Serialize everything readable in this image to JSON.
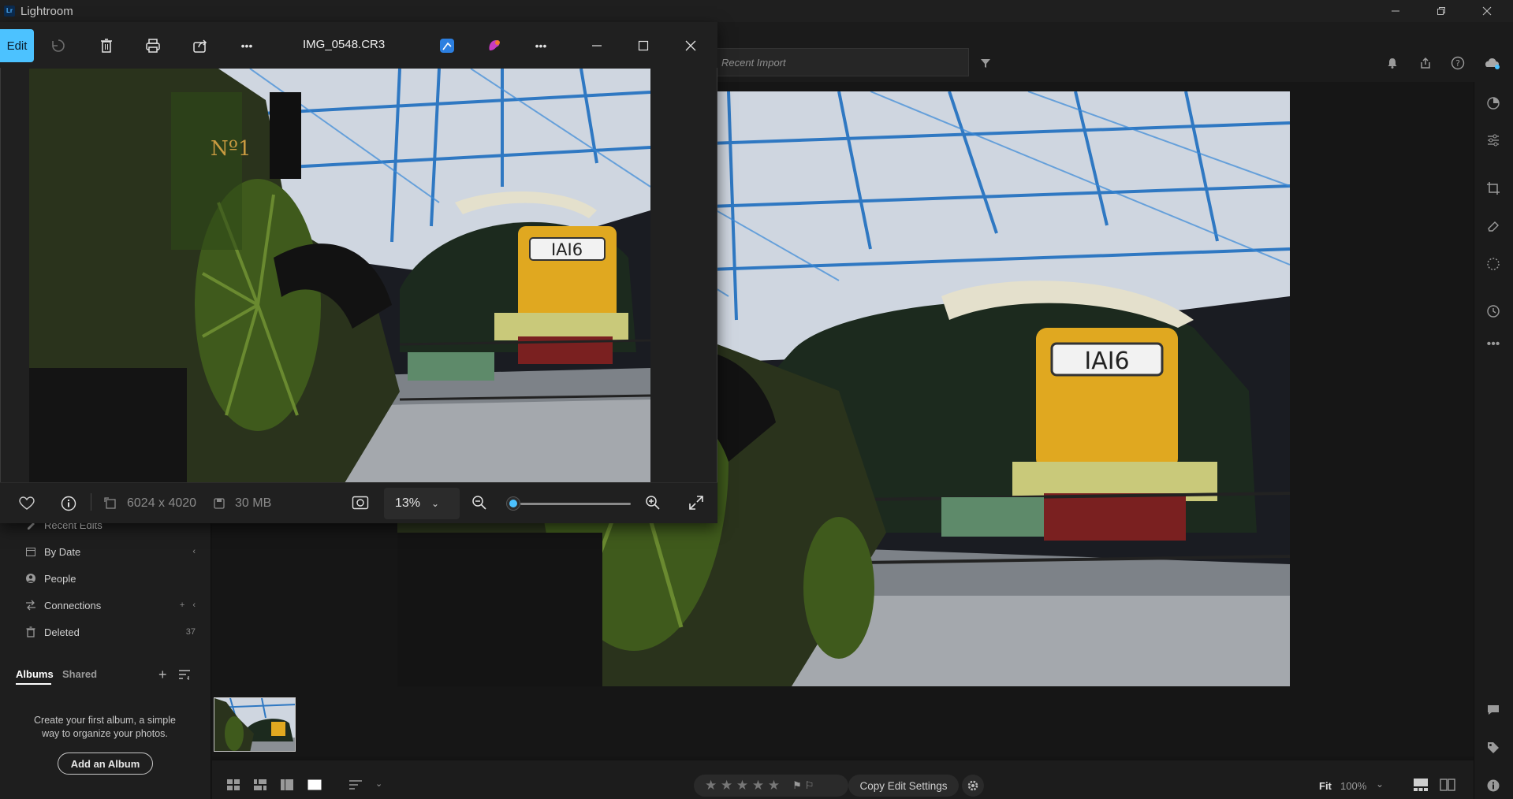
{
  "app": {
    "title": "Lightroom",
    "logo_text": "Lr"
  },
  "topbar": {
    "search_placeholder": "Recent Import"
  },
  "sidebar": {
    "items": [
      {
        "label": "Recent Edits",
        "icon": "recent-edits-icon"
      },
      {
        "label": "By Date",
        "icon": "calendar-icon"
      },
      {
        "label": "People",
        "icon": "person-icon"
      },
      {
        "label": "Connections",
        "icon": "connections-icon"
      },
      {
        "label": "Deleted",
        "icon": "trash-icon",
        "count": "37"
      }
    ],
    "albums_tab": "Albums",
    "shared_tab": "Shared",
    "album_hint": "Create your first album, a simple way to organize your photos.",
    "add_album_label": "Add an Album"
  },
  "bottombar": {
    "stars": "★ ★ ★ ★ ★",
    "copy_edit_label": "Copy Edit Settings",
    "fit_label": "Fit",
    "zoom_label": "100%"
  },
  "viewer": {
    "edit_label": "Edit",
    "filename": "IMG_0548.CR3",
    "dimensions": "6024 x 4020",
    "filesize": "30 MB",
    "zoom_value": "13%",
    "zoom_level": 0.13
  },
  "colors": {
    "accent": "#4cc2ff",
    "sign_green": "#5e8a6a",
    "loco_yellow": "#e0a820"
  }
}
